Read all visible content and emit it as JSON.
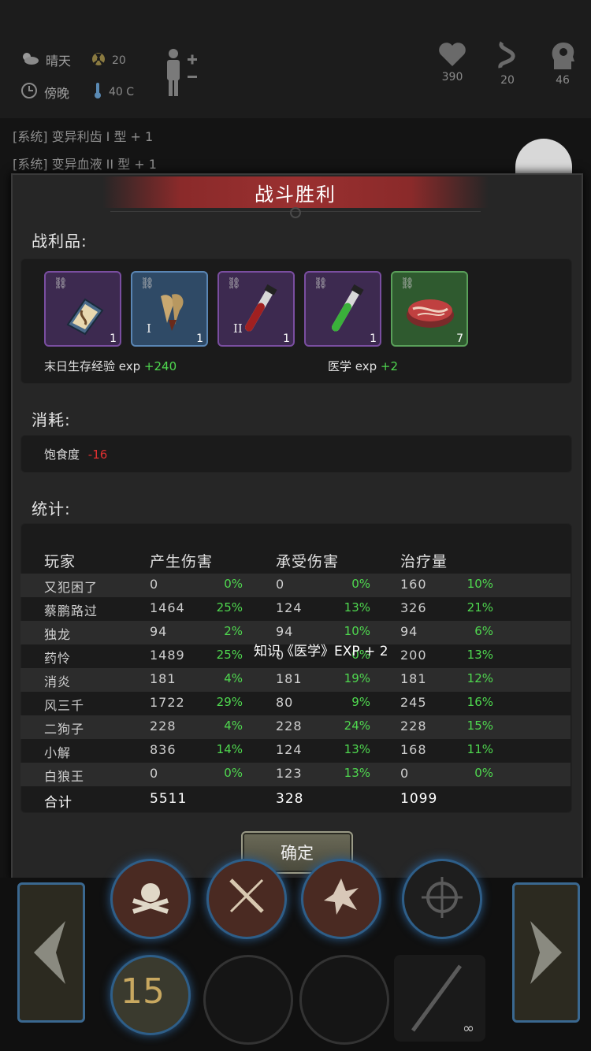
{
  "status": {
    "weather": "晴天",
    "radiation": "20",
    "time": "傍晚",
    "temperature": "40 C",
    "health": "390",
    "hunger": "20",
    "mental": "46"
  },
  "log": [
    "[系统] 变异利齿 I 型 + 1",
    "[系统] 变异血液 II 型 + 1"
  ],
  "dialog": {
    "title": "战斗胜利",
    "loot_label": "战利品:",
    "items": [
      {
        "name": "book",
        "count": "1",
        "roman": ""
      },
      {
        "name": "mutant-teeth",
        "count": "1",
        "roman": "I"
      },
      {
        "name": "mutant-blood",
        "count": "1",
        "roman": "II"
      },
      {
        "name": "green-tube",
        "count": "1",
        "roman": ""
      },
      {
        "name": "meat",
        "count": "7",
        "roman": ""
      }
    ],
    "exp1_label": "末日生存经验 exp",
    "exp1_value": "+240",
    "exp2_label": "医学 exp",
    "exp2_value": "+2",
    "consume_label": "消耗:",
    "satiety_label": "饱食度",
    "satiety_value": "-16",
    "stats_label": "统计:",
    "headers": [
      "玩家",
      "产生伤害",
      "承受伤害",
      "治疗量"
    ],
    "rows": [
      {
        "name": "又犯困了",
        "dmg": "0",
        "dmg_pct": "0%",
        "taken": "0",
        "taken_pct": "0%",
        "heal": "160",
        "heal_pct": "10%"
      },
      {
        "name": "蔡鹏路过",
        "dmg": "1464",
        "dmg_pct": "25%",
        "taken": "124",
        "taken_pct": "13%",
        "heal": "326",
        "heal_pct": "21%"
      },
      {
        "name": "独龙",
        "dmg": "94",
        "dmg_pct": "2%",
        "taken": "94",
        "taken_pct": "10%",
        "heal": "94",
        "heal_pct": "6%"
      },
      {
        "name": "药怜",
        "dmg": "1489",
        "dmg_pct": "25%",
        "taken": "0",
        "taken_pct": "0%",
        "heal": "200",
        "heal_pct": "13%"
      },
      {
        "name": "消炎",
        "dmg": "181",
        "dmg_pct": "4%",
        "taken": "181",
        "taken_pct": "19%",
        "heal": "181",
        "heal_pct": "12%"
      },
      {
        "name": "风三千",
        "dmg": "1722",
        "dmg_pct": "29%",
        "taken": "80",
        "taken_pct": "9%",
        "heal": "245",
        "heal_pct": "16%"
      },
      {
        "name": "二狗子",
        "dmg": "228",
        "dmg_pct": "4%",
        "taken": "228",
        "taken_pct": "24%",
        "heal": "228",
        "heal_pct": "15%"
      },
      {
        "name": "小解",
        "dmg": "836",
        "dmg_pct": "14%",
        "taken": "124",
        "taken_pct": "13%",
        "heal": "168",
        "heal_pct": "11%"
      },
      {
        "name": "白狼王",
        "dmg": "0",
        "dmg_pct": "0%",
        "taken": "123",
        "taken_pct": "13%",
        "heal": "0",
        "heal_pct": "0%"
      }
    ],
    "total": {
      "name": "合计",
      "dmg": "5511",
      "taken": "328",
      "heal": "1099"
    },
    "toast": "知识《医学》EXP + 2",
    "confirm": "确定"
  },
  "bottom": {
    "level_badge": "15",
    "infinity": "∞"
  }
}
